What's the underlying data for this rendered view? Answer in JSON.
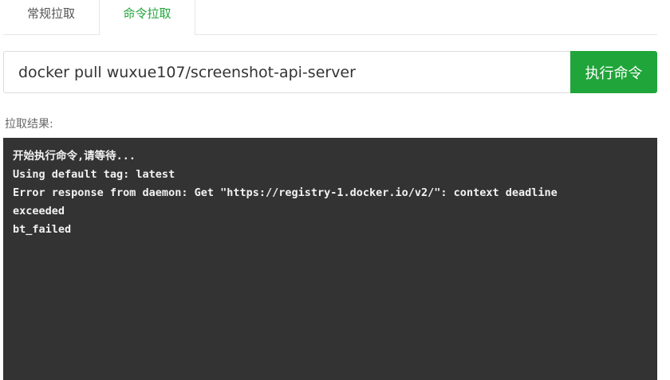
{
  "tabs": [
    {
      "label": "常规拉取",
      "active": false
    },
    {
      "label": "命令拉取",
      "active": true
    }
  ],
  "command": {
    "value": "docker pull wuxue107/screenshot-api-server",
    "button_label": "执行命令"
  },
  "result": {
    "label": "拉取结果:",
    "lines": [
      "开始执行命令,请等待...",
      "Using default tag: latest",
      "Error response from daemon: Get \"https://registry-1.docker.io/v2/\": context deadline",
      "exceeded",
      "bt_failed"
    ]
  },
  "colors": {
    "accent": "#20a53a",
    "terminal_bg": "#333333",
    "terminal_text": "#f2f2f2"
  }
}
